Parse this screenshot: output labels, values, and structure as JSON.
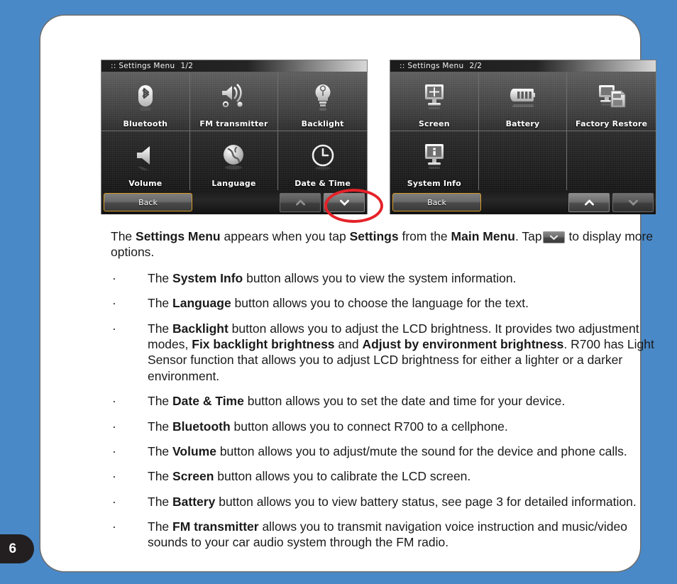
{
  "page": {
    "number": "6",
    "background_color": "#4a89c8",
    "sheet_color": "#ffffff"
  },
  "screenshots": [
    {
      "id": "settings-menu-page-1",
      "titlebar_prefix": ":: Settings Menu",
      "titlebar_page": "1/2",
      "cells": [
        {
          "label": "Bluetooth",
          "icon": "bluetooth-icon"
        },
        {
          "label": "FM transmitter",
          "icon": "fm-transmitter-icon"
        },
        {
          "label": "Backlight",
          "icon": "lightbulb-icon"
        },
        {
          "label": "Volume",
          "icon": "speaker-icon"
        },
        {
          "label": "Language",
          "icon": "globe-icon"
        },
        {
          "label": "Date & Time",
          "icon": "clock-icon"
        }
      ],
      "back_label": "Back",
      "up_enabled": false,
      "down_enabled": true,
      "highlighted_control": "down-chevron-button"
    },
    {
      "id": "settings-menu-page-2",
      "titlebar_prefix": ":: Settings Menu",
      "titlebar_page": "2/2",
      "cells": [
        {
          "label": "Screen",
          "icon": "monitor-calibrate-icon"
        },
        {
          "label": "Battery",
          "icon": "battery-icon"
        },
        {
          "label": "Factory Restore",
          "icon": "factory-restore-icon"
        },
        {
          "label": "System Info",
          "icon": "monitor-info-icon"
        },
        {
          "label": "",
          "icon": ""
        },
        {
          "label": "",
          "icon": ""
        }
      ],
      "back_label": "Back",
      "up_enabled": true,
      "down_enabled": false,
      "highlighted_control": ""
    }
  ],
  "body": {
    "intro": {
      "part1": "The ",
      "bold1": "Settings Menu",
      "part2": " appears when you tap ",
      "bold2": "Settings",
      "part3": " from the ",
      "bold3": "Main Menu",
      "part4": ". Tap",
      "part5": " to display more options."
    },
    "bullet_marker": "·",
    "bullets": [
      {
        "pre": "The ",
        "bold": "System Info",
        "post": " button allows you to view the system information."
      },
      {
        "pre": "The ",
        "bold": "Language",
        "post": " button allows you to choose the language for the text."
      },
      {
        "pre": "The ",
        "bold": "Backlight",
        "post": " button allows you to adjust the LCD brightness. It provides two adjustment modes, ",
        "bold2": "Fix backlight brightness",
        "mid2": " and ",
        "bold3": "Adjust by environment brightness",
        "post2": ". R700 has Light Sensor function that allows you to adjust LCD brightness for either a lighter or a darker environment."
      },
      {
        "pre": "The ",
        "bold": "Date & Time",
        "post": " button allows you to set the date and time for your device."
      },
      {
        "pre": "The ",
        "bold": "Bluetooth",
        "post": " button allows you to connect R700 to a cellphone."
      },
      {
        "pre": "The ",
        "bold": "Volume",
        "post": " button allows you to adjust/mute the sound for the device and phone calls."
      },
      {
        "pre": "The ",
        "bold": "Screen",
        "post": " button allows you to calibrate the LCD screen."
      },
      {
        "pre": "The ",
        "bold": "Battery",
        "post": " button allows you to view battery status, see page 3 for detailed information."
      },
      {
        "pre": "The ",
        "bold": "FM transmitter",
        "post": " allows you to transmit navigation voice instruction and music/video sounds to your car audio system through the FM radio."
      }
    ]
  }
}
